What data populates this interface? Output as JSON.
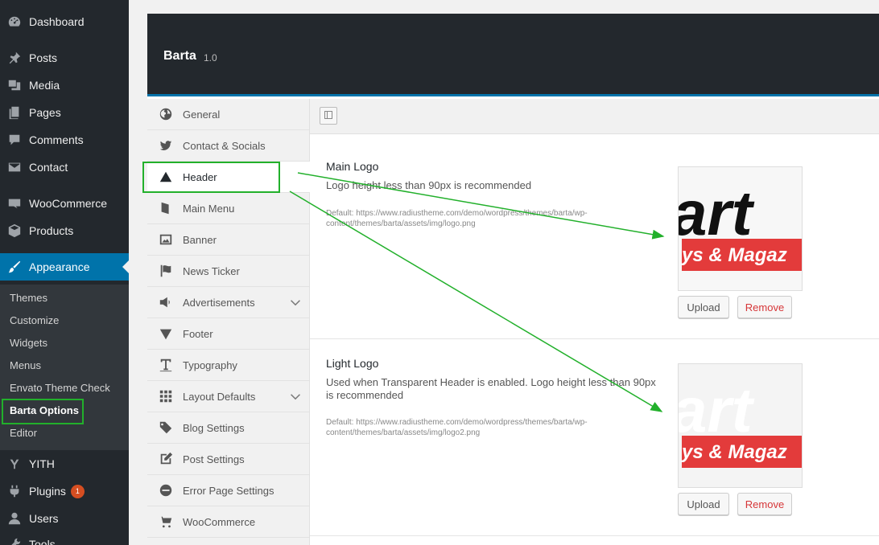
{
  "sidebar": {
    "items": [
      {
        "label": "Dashboard",
        "icon": "dashboard-icon"
      },
      {
        "label": "Posts",
        "icon": "pin-icon"
      },
      {
        "label": "Media",
        "icon": "media-icon"
      },
      {
        "label": "Pages",
        "icon": "pages-icon"
      },
      {
        "label": "Comments",
        "icon": "comment-icon"
      },
      {
        "label": "Contact",
        "icon": "mail-icon"
      },
      {
        "label": "WooCommerce",
        "icon": "woo-icon"
      },
      {
        "label": "Products",
        "icon": "box-icon"
      },
      {
        "label": "Appearance",
        "icon": "brush-icon"
      },
      {
        "label": "YITH",
        "icon": "yith-icon"
      },
      {
        "label": "Plugins",
        "icon": "plugin-icon",
        "badge": "1"
      },
      {
        "label": "Users",
        "icon": "user-icon"
      },
      {
        "label": "Tools",
        "icon": "tools-icon"
      }
    ],
    "appearance_submenu": [
      "Themes",
      "Customize",
      "Widgets",
      "Menus",
      "Envato Theme Check",
      "Barta Options",
      "Editor"
    ]
  },
  "panel": {
    "title": "Barta",
    "version": "1.0"
  },
  "nav": [
    {
      "label": "General",
      "icon": "globe-icon"
    },
    {
      "label": "Contact & Socials",
      "icon": "twitter-icon"
    },
    {
      "label": "Header",
      "icon": "triangle-up-icon"
    },
    {
      "label": "Main Menu",
      "icon": "book-icon"
    },
    {
      "label": "Banner",
      "icon": "image-icon"
    },
    {
      "label": "News Ticker",
      "icon": "flag-icon"
    },
    {
      "label": "Advertisements",
      "icon": "megaphone-icon"
    },
    {
      "label": "Footer",
      "icon": "triangle-down-icon"
    },
    {
      "label": "Typography",
      "icon": "text-icon"
    },
    {
      "label": "Layout Defaults",
      "icon": "grid-icon"
    },
    {
      "label": "Blog Settings",
      "icon": "tags-icon"
    },
    {
      "label": "Post Settings",
      "icon": "edit-icon"
    },
    {
      "label": "Error Page Settings",
      "icon": "minus-circle-icon"
    },
    {
      "label": "WooCommerce",
      "icon": "cart-icon"
    }
  ],
  "options": {
    "main_logo": {
      "title": "Main Logo",
      "desc": "Logo height less than 90px is recommended",
      "default": "Default: https://www.radiustheme.com/demo/wordpress/themes/barta/wp-content/themes/barta/assets/img/logo.png",
      "upload": "Upload",
      "remove": "Remove"
    },
    "light_logo": {
      "title": "Light Logo",
      "desc": "Used when Transparent Header is enabled. Logo height less than 90px is recommended",
      "default": "Default: https://www.radiustheme.com/demo/wordpress/themes/barta/wp-content/themes/barta/assets/img/logo2.png",
      "upload": "Upload",
      "remove": "Remove"
    },
    "logo_text_top": "art",
    "logo_text_bottom": "ys & Magaz"
  },
  "colors": {
    "sidebar_bg": "#23282d",
    "accent": "#0073aa",
    "highlight": "#22b02b",
    "logo_red": "#e33b3b"
  }
}
